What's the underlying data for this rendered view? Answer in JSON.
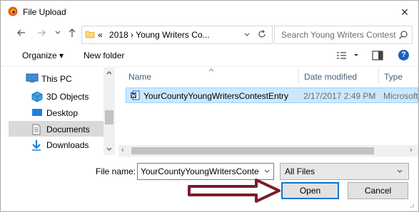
{
  "window": {
    "title": "File Upload",
    "close": "✕"
  },
  "address": {
    "prefix": "«",
    "path": "2018 › Young Writers Co...",
    "search_placeholder": "Search Young Writers Contest"
  },
  "toolbar": {
    "organize": "Organize ▾",
    "new_folder": "New folder",
    "help": "?"
  },
  "navpane": {
    "items": [
      {
        "label": "This PC",
        "icon": "pc-icon"
      },
      {
        "label": "3D Objects",
        "icon": "cube-icon"
      },
      {
        "label": "Desktop",
        "icon": "desktop-icon"
      },
      {
        "label": "Documents",
        "icon": "documents-icon",
        "selected": true
      },
      {
        "label": "Downloads",
        "icon": "download-icon"
      }
    ]
  },
  "columns": {
    "name": "Name",
    "date": "Date modified",
    "type": "Type"
  },
  "files": [
    {
      "name": "YourCountyYoungWritersContestEntry",
      "date": "2/17/2017 2:49 PM",
      "type": "Microsoft"
    }
  ],
  "bottom": {
    "filename_label": "File name:",
    "filename_value": "YourCountyYoungWritersContestE",
    "filter": "All Files",
    "open": "Open",
    "cancel": "Cancel"
  },
  "colors": {
    "accent": "#0078d7",
    "selection": "#cce8ff",
    "arrow": "#7b1a2c"
  }
}
